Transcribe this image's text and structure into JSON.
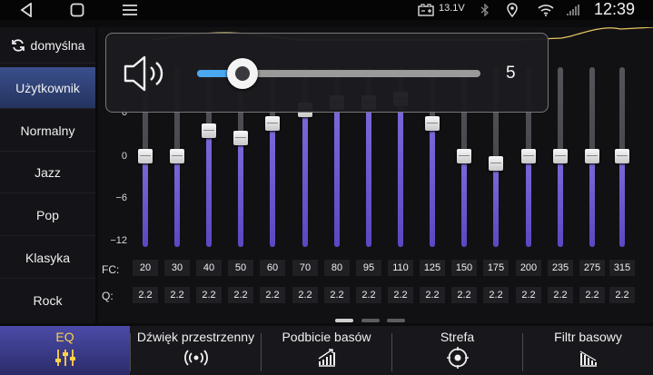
{
  "statusbar": {
    "voltage": "13.1V",
    "clock": "12:39",
    "icons": [
      "back-icon",
      "home-icon",
      "menu-icon",
      "battery-icon",
      "bluetooth-icon",
      "location-icon",
      "wifi-icon",
      "signal-icon"
    ]
  },
  "presets": {
    "default_label": "domyślna",
    "items": [
      "Użytkownik",
      "Normalny",
      "Jazz",
      "Pop",
      "Klasyka",
      "Rock"
    ],
    "active_index": 0
  },
  "eq": {
    "y_ticks": [
      "0",
      "−6",
      "−12"
    ],
    "y_range": [
      -12,
      12
    ],
    "fc_label": "FC:",
    "q_label": "Q:",
    "bands": [
      {
        "fc": "20",
        "q": "2.2",
        "gain": 0
      },
      {
        "fc": "30",
        "q": "2.2",
        "gain": 0
      },
      {
        "fc": "40",
        "q": "2.2",
        "gain": 3.5
      },
      {
        "fc": "50",
        "q": "2.2",
        "gain": 2.5
      },
      {
        "fc": "60",
        "q": "2.2",
        "gain": 4.5
      },
      {
        "fc": "70",
        "q": "2.2",
        "gain": 6.5
      },
      {
        "fc": "80",
        "q": "2.2",
        "gain": 7.5
      },
      {
        "fc": "95",
        "q": "2.2",
        "gain": 7.5
      },
      {
        "fc": "110",
        "q": "2.2",
        "gain": 8
      },
      {
        "fc": "125",
        "q": "2.2",
        "gain": 4.5
      },
      {
        "fc": "150",
        "q": "2.2",
        "gain": 0
      },
      {
        "fc": "175",
        "q": "2.2",
        "gain": -1
      },
      {
        "fc": "200",
        "q": "2.2",
        "gain": 0
      },
      {
        "fc": "235",
        "q": "2.2",
        "gain": 0
      },
      {
        "fc": "275",
        "q": "2.2",
        "gain": 0
      },
      {
        "fc": "315",
        "q": "2.2",
        "gain": 0
      }
    ]
  },
  "volume": {
    "value": "5",
    "level_fraction": 0.16
  },
  "pager": {
    "count": 3,
    "active_index": 0
  },
  "tabs": [
    {
      "label": "EQ",
      "icon": "sliders-icon",
      "active": true
    },
    {
      "label": "Dźwięk przestrzenny",
      "icon": "surround-icon",
      "active": false
    },
    {
      "label": "Podbicie basów",
      "icon": "bass-boost-icon",
      "active": false
    },
    {
      "label": "Strefa",
      "icon": "zone-icon",
      "active": false
    },
    {
      "label": "Filtr basowy",
      "icon": "bass-filter-icon",
      "active": false
    }
  ],
  "colors": {
    "accent_purple": "#6a58d0",
    "active_tab_text": "#ffd24a",
    "volume_fill": "#4aa8f0",
    "preset_active": "#2e4178"
  }
}
